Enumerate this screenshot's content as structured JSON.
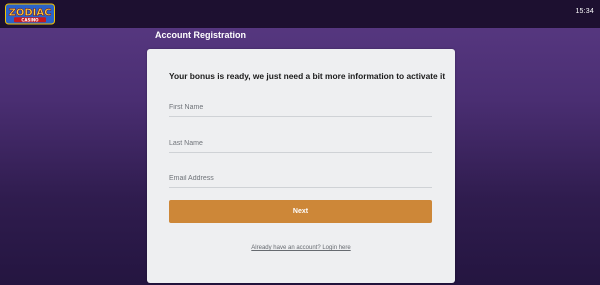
{
  "header": {
    "brand_name": "ZODIAC",
    "brand_subtitle": "CASINO",
    "clock": "15:34"
  },
  "page": {
    "title": "Account Registration"
  },
  "form": {
    "headline": "Your bonus is ready, we just need a bit more information to activate it",
    "first_name_placeholder": "First Name",
    "last_name_placeholder": "Last Name",
    "email_placeholder": "Email Address",
    "next_label": "Next",
    "login_link": "Already have an account? Login here"
  },
  "colors": {
    "accent": "#cd8738",
    "background_top": "#5a3a84",
    "background_bottom": "#241540",
    "card": "#eeeff1"
  }
}
